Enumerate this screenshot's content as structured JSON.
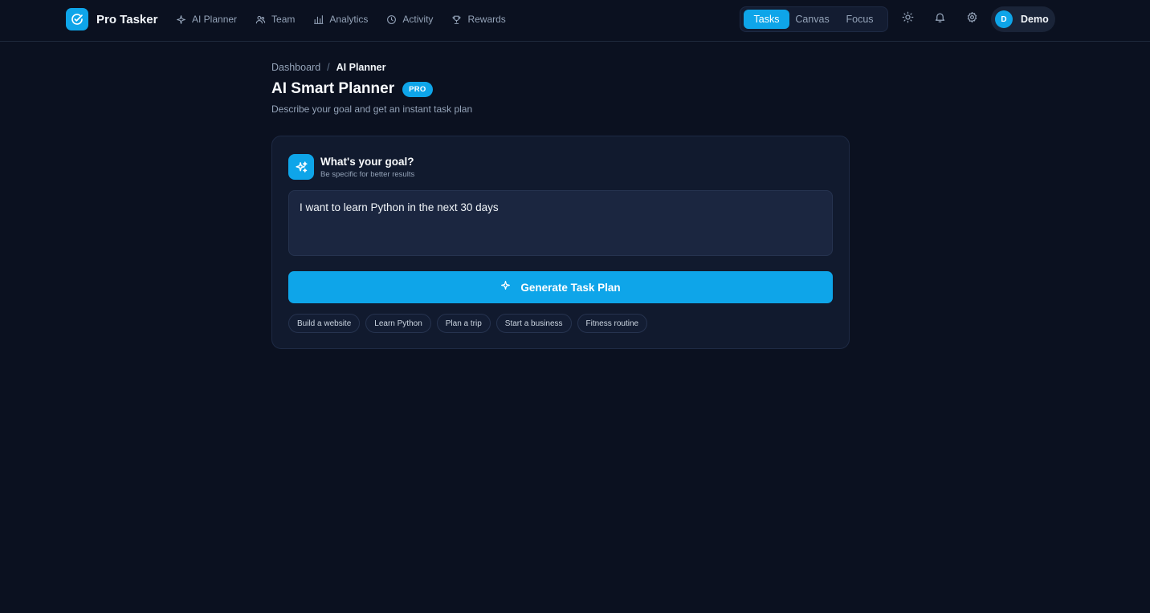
{
  "brand": {
    "name": "Pro Tasker",
    "logo_icon": "check-circle-icon"
  },
  "nav": {
    "items": [
      {
        "label": "AI Planner",
        "icon": "sparkle-icon"
      },
      {
        "label": "Team",
        "icon": "users-icon"
      },
      {
        "label": "Analytics",
        "icon": "bar-chart-icon"
      },
      {
        "label": "Activity",
        "icon": "clock-icon"
      },
      {
        "label": "Rewards",
        "icon": "trophy-icon"
      }
    ]
  },
  "view_switch": {
    "tabs": [
      "Tasks",
      "Canvas",
      "Focus"
    ],
    "active": "Tasks"
  },
  "toolbar": {
    "icons": [
      "sun-icon",
      "bell-icon",
      "gear-icon"
    ]
  },
  "user": {
    "initial": "D",
    "name": "Demo"
  },
  "breadcrumb": {
    "parent": "Dashboard",
    "separator": "/",
    "current": "AI Planner"
  },
  "page": {
    "title": "AI Smart Planner",
    "badge": "PRO",
    "subtitle": "Describe your goal and get an instant task plan"
  },
  "goal_card": {
    "title": "What's your goal?",
    "subtitle": "Be specific for better results",
    "input_value": "I want to learn Python in the next 30 days",
    "generate_label": "Generate Task Plan",
    "suggestions": [
      "Build a website",
      "Learn Python",
      "Plan a trip",
      "Start a business",
      "Fitness routine"
    ]
  },
  "colors": {
    "background": "#0b1120",
    "accent": "#0ea5e9",
    "card": "#111a2e",
    "input": "#1b2640"
  }
}
